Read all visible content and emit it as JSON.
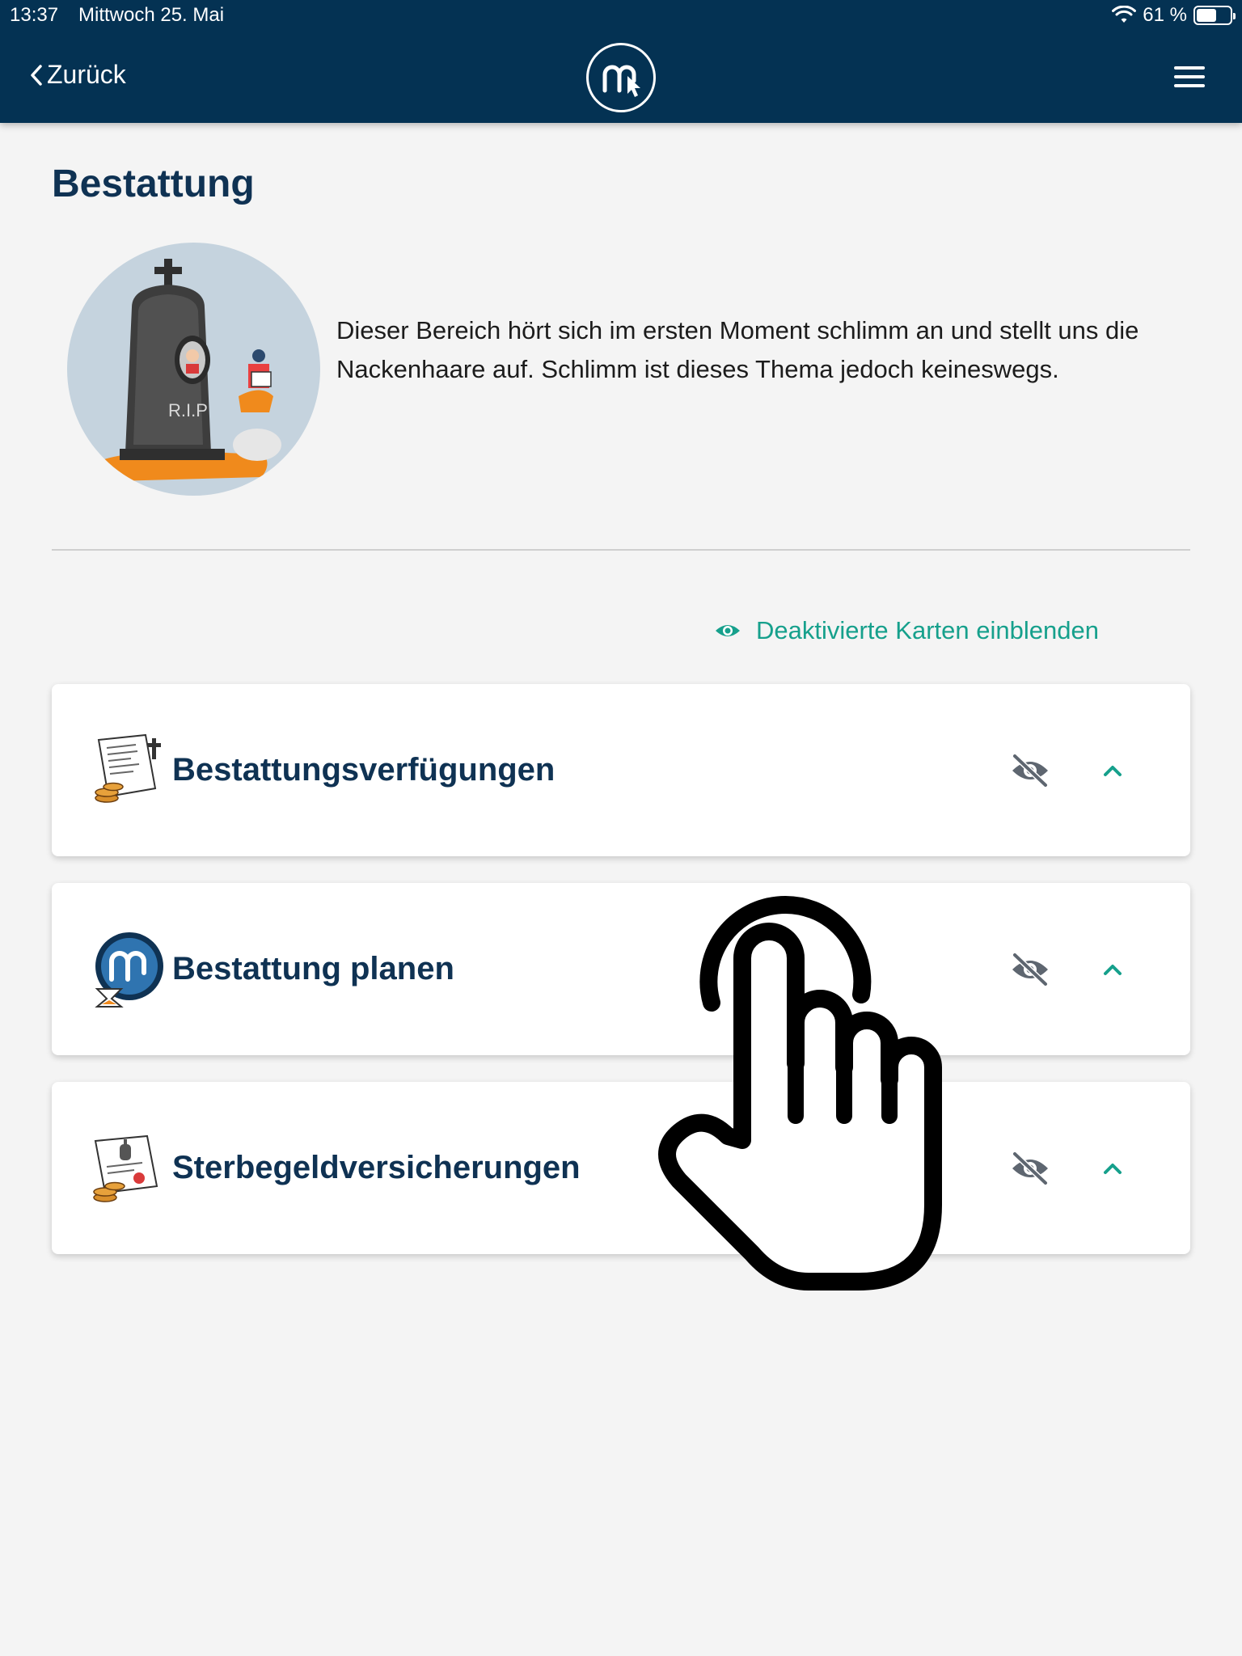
{
  "status_bar": {
    "time": "13:37",
    "date": "Mittwoch 25. Mai",
    "battery": "61 %",
    "battery_level": 0.61
  },
  "header": {
    "back_label": "Zurück",
    "logo_icon": "brand-logo-icon",
    "menu_icon": "hamburger-menu-icon"
  },
  "page": {
    "title": "Bestattung",
    "intro": "Dieser Bereich hört sich im ersten Moment schlimm an und stellt uns die Nackenhaare auf. Schlimm ist dieses Thema jedoch keineswegs.",
    "illustration_text": "R.I.P",
    "toggle_label": "Deaktivierte Karten einblenden"
  },
  "cards": [
    {
      "title": "Bestattungsverfügungen",
      "icon": "funeral-document-icon"
    },
    {
      "title": "Bestattung planen",
      "icon": "brand-hourglass-icon"
    },
    {
      "title": "Sterbegeldversicherungen",
      "icon": "insurance-certificate-icon"
    }
  ],
  "colors": {
    "header_bg": "#043253",
    "accent": "#16a08c",
    "title": "#0f3253",
    "background": "#f4f4f4"
  }
}
